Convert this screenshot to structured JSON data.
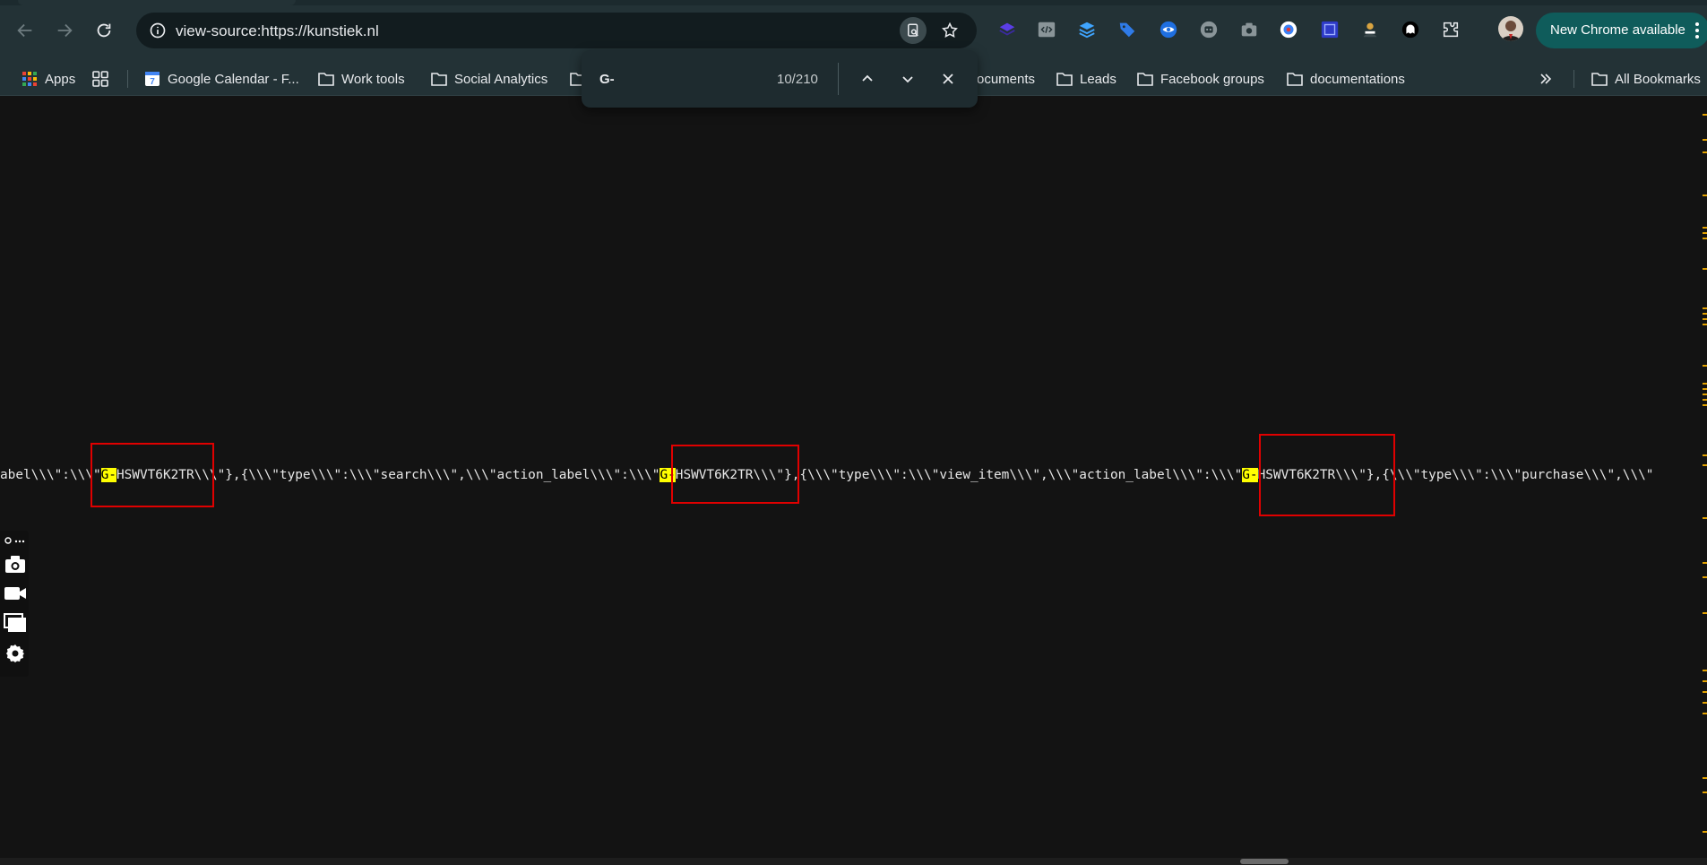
{
  "browser": {
    "url": "view-source:https://kunstiek.nl",
    "new_chrome_label": "New Chrome available"
  },
  "bookmarks": [
    {
      "label": "Apps"
    },
    {
      "label": "Google Calendar - F..."
    },
    {
      "label": "Work tools"
    },
    {
      "label": "Social Analytics"
    },
    {
      "label": "ocuments"
    },
    {
      "label": "Leads"
    },
    {
      "label": "Facebook groups"
    },
    {
      "label": "documentations"
    },
    {
      "label": "All Bookmarks"
    }
  ],
  "find": {
    "query": "G-",
    "count": "10/210"
  },
  "source": {
    "seg1": "abel\\\\\\\":\\\\\\\"",
    "m1": "G-",
    "seg2": "HSWVT6K2TR\\\\\\\"},{\\\\\\\"type\\\\\\\":\\\\\\\"search\\\\\\\",\\\\\\\"action_label\\\\\\\":\\\\\\\"",
    "m2": "G-",
    "seg3": "HSWVT6K2TR\\\\\\\"},{\\\\\\\"type\\\\\\\":\\\\\\\"view_item\\\\\\\",\\\\\\\"action_label\\\\\\\":\\\\\\\"",
    "m3": "G-",
    "seg4": "HSWVT6K2TR\\\\\\\"},{\\\\\\\"type\\\\\\\":\\\\\\\"purchase\\\\\\\",\\\\\\\""
  },
  "colors": {
    "toolbar": "#233236",
    "highlight": "#ffff00",
    "annotation": "#e00000",
    "update_button": "#0f5c5b"
  }
}
